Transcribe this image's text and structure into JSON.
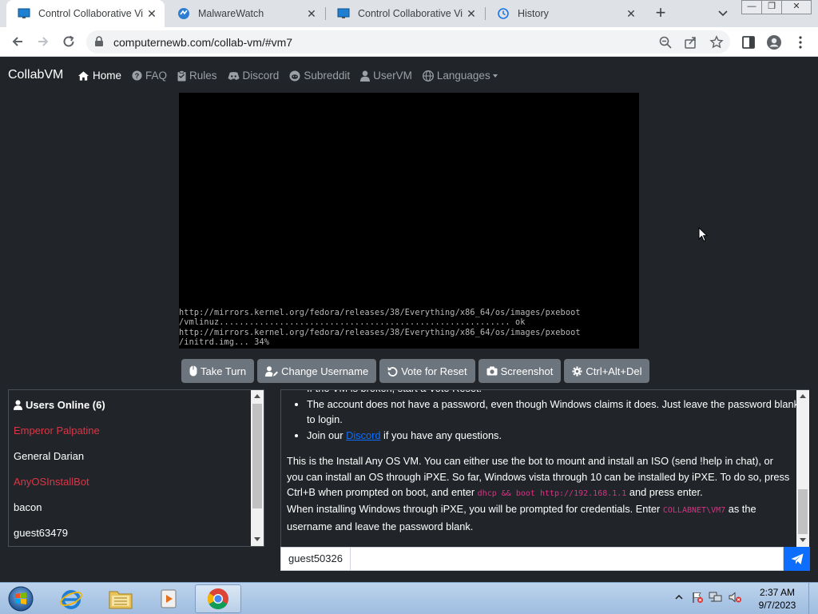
{
  "browser": {
    "tabs": [
      {
        "title": "Control Collaborative Vir",
        "close": "✕"
      },
      {
        "title": "MalwareWatch",
        "close": "✕"
      },
      {
        "title": "Control Collaborative Vir",
        "close": "✕"
      },
      {
        "title": "History",
        "close": "✕"
      }
    ],
    "new_tab": "+",
    "url": "computernewb.com/collab-vm/#vm7",
    "window_controls": [
      "—",
      "❐",
      "✕"
    ]
  },
  "navbar": {
    "brand": "CollabVM",
    "links": [
      {
        "label": "Home",
        "icon": "home-icon"
      },
      {
        "label": "FAQ",
        "icon": "question-circle-icon"
      },
      {
        "label": "Rules",
        "icon": "clipboard-icon"
      },
      {
        "label": "Discord",
        "icon": "discord-icon"
      },
      {
        "label": "Subreddit",
        "icon": "reddit-icon"
      },
      {
        "label": "UserVM",
        "icon": "user-icon"
      },
      {
        "label": "Languages",
        "icon": "globe-icon"
      }
    ]
  },
  "vm": {
    "console_lines": [
      "http://mirrors.kernel.org/fedora/releases/38/Everything/x86_64/os/images/pxeboot",
      "/vmlinuz.......................................................... ok",
      "http://mirrors.kernel.org/fedora/releases/38/Everything/x86_64/os/images/pxeboot",
      "/initrd.img... 34%"
    ],
    "buttons": [
      {
        "label": "Take Turn",
        "icon": "mouse-icon"
      },
      {
        "label": "Change Username",
        "icon": "user-edit-icon"
      },
      {
        "label": "Vote for Reset",
        "icon": "reset-icon"
      },
      {
        "label": "Screenshot",
        "icon": "camera-icon"
      },
      {
        "label": "Ctrl+Alt+Del",
        "icon": "gear-icon"
      }
    ]
  },
  "users": {
    "header": "Users Online (6)",
    "list": [
      {
        "name": "Emperor Palpatine",
        "color": "#dc3545"
      },
      {
        "name": "General Darian",
        "color": "#ffffff"
      },
      {
        "name": "AnyOSInstallBot",
        "color": "#dc3545"
      },
      {
        "name": "bacon",
        "color": "#ffffff"
      },
      {
        "name": "guest63479",
        "color": "#ffffff"
      }
    ]
  },
  "chat": {
    "bullet_cut": "If the VM is broken, start a Vote Reset.",
    "bullet_account": "The account does not have a password, even though Windows claims it does. Just leave the password blank to login.",
    "join_pre": "Join our ",
    "join_link": "Discord",
    "join_post": " if you have any questions.",
    "para1_a": "This is the Install Any OS VM. You can either use the bot to mount and install an ISO (send !help in chat), or you can install an OS through iPXE. So far, Windows vista through 10 can be installed by iPXE. To do so, press Ctrl+B when prompted on boot, and enter ",
    "para1_code": "dhcp && boot http://192.168.1.1",
    "para1_b": " and press enter.",
    "para2_a": "When installing Windows through iPXE, you will be prompted for credentials. Enter ",
    "para2_code": "COLLABNET\\VM7",
    "para2_b": " as the username and leave the password blank.",
    "username": "guest50326"
  },
  "taskbar": {
    "time": "2:37 AM",
    "date": "9/7/2023"
  },
  "colors": {
    "page_bg": "#212529",
    "secondary_button": "#6c757d",
    "primary": "#0d6efd",
    "danger_user": "#dc3545"
  }
}
